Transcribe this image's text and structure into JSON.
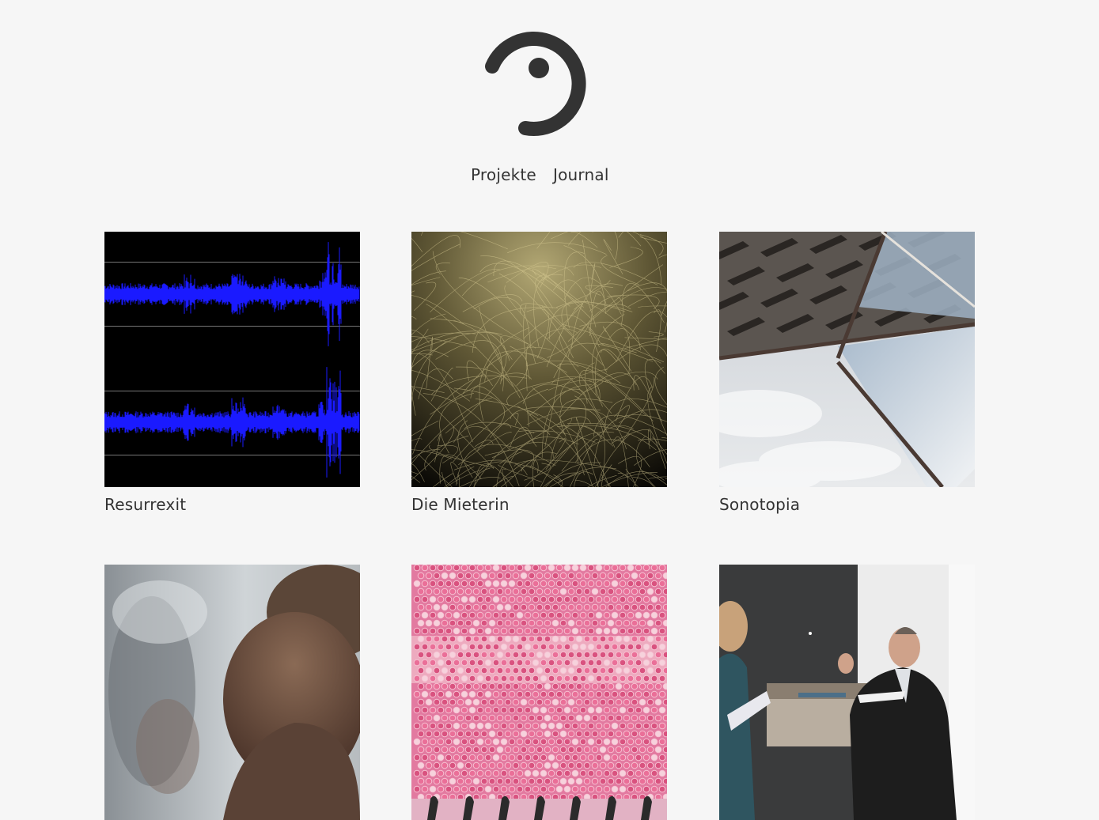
{
  "site": {
    "logo_icon": "ear-icon",
    "accent_color": "#333333",
    "background_color": "#f6f6f6"
  },
  "nav": {
    "items": [
      {
        "label": "Projekte"
      },
      {
        "label": "Journal"
      }
    ]
  },
  "projects": [
    {
      "title": "Resurrexit",
      "image": "waveform-image"
    },
    {
      "title": "Die Mieterin",
      "image": "golden-fibers-image"
    },
    {
      "title": "Sonotopia",
      "image": "drain-grate-mirror-image"
    },
    {
      "title": "",
      "image": "people-in-haze-image"
    },
    {
      "title": "",
      "image": "pink-sequins-image"
    },
    {
      "title": "",
      "image": "panel-discussion-image"
    }
  ]
}
